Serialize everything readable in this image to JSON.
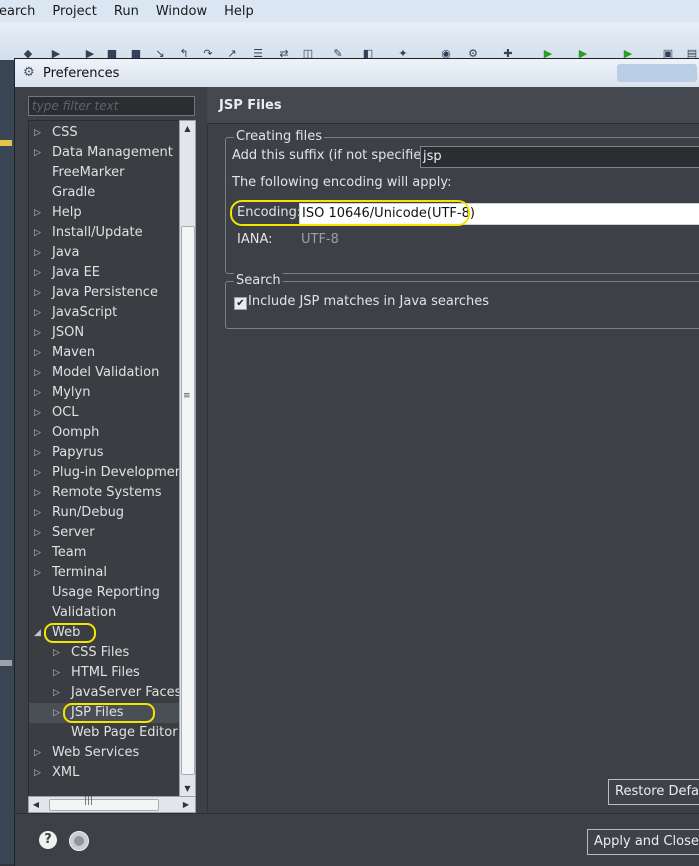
{
  "menubar": {
    "items": [
      "earch",
      "Project",
      "Run",
      "Window",
      "Help"
    ]
  },
  "dialog": {
    "title": "Preferences"
  },
  "filter": {
    "placeholder": "type filter text"
  },
  "tree": {
    "items": [
      {
        "label": "CSS",
        "arrow": "▷",
        "level": 0
      },
      {
        "label": "Data Management",
        "arrow": "▷",
        "level": 0
      },
      {
        "label": "FreeMarker",
        "arrow": "",
        "level": 0
      },
      {
        "label": "Gradle",
        "arrow": "",
        "level": 0
      },
      {
        "label": "Help",
        "arrow": "▷",
        "level": 0
      },
      {
        "label": "Install/Update",
        "arrow": "▷",
        "level": 0
      },
      {
        "label": "Java",
        "arrow": "▷",
        "level": 0
      },
      {
        "label": "Java EE",
        "arrow": "▷",
        "level": 0
      },
      {
        "label": "Java Persistence",
        "arrow": "▷",
        "level": 0
      },
      {
        "label": "JavaScript",
        "arrow": "▷",
        "level": 0
      },
      {
        "label": "JSON",
        "arrow": "▷",
        "level": 0
      },
      {
        "label": "Maven",
        "arrow": "▷",
        "level": 0
      },
      {
        "label": "Model Validation",
        "arrow": "▷",
        "level": 0
      },
      {
        "label": "Mylyn",
        "arrow": "▷",
        "level": 0
      },
      {
        "label": "OCL",
        "arrow": "▷",
        "level": 0
      },
      {
        "label": "Oomph",
        "arrow": "▷",
        "level": 0
      },
      {
        "label": "Papyrus",
        "arrow": "▷",
        "level": 0
      },
      {
        "label": "Plug-in Development",
        "arrow": "▷",
        "level": 0
      },
      {
        "label": "Remote Systems",
        "arrow": "▷",
        "level": 0
      },
      {
        "label": "Run/Debug",
        "arrow": "▷",
        "level": 0
      },
      {
        "label": "Server",
        "arrow": "▷",
        "level": 0
      },
      {
        "label": "Team",
        "arrow": "▷",
        "level": 0
      },
      {
        "label": "Terminal",
        "arrow": "▷",
        "level": 0
      },
      {
        "label": "Usage Reporting",
        "arrow": "",
        "level": 0
      },
      {
        "label": "Validation",
        "arrow": "",
        "level": 0
      },
      {
        "label": "Web",
        "arrow": "◢",
        "level": 0
      },
      {
        "label": "CSS Files",
        "arrow": "▷",
        "level": 1
      },
      {
        "label": "HTML Files",
        "arrow": "▷",
        "level": 1
      },
      {
        "label": "JavaServer Faces T",
        "arrow": "▷",
        "level": 1
      },
      {
        "label": "JSP Files",
        "arrow": "▷",
        "level": 1
      },
      {
        "label": "Web Page Editor",
        "arrow": "",
        "level": 1
      },
      {
        "label": "Web Services",
        "arrow": "▷",
        "level": 0
      },
      {
        "label": "XML",
        "arrow": "▷",
        "level": 0
      }
    ]
  },
  "page": {
    "title": "JSP Files",
    "creating_group": {
      "legend": "Creating files",
      "suffix_label": "Add this suffix (if not specified):",
      "suffix_value": "jsp",
      "encoding_note": "The following encoding will apply:",
      "encoding_label": "Encoding:",
      "encoding_value": "ISO 10646/Unicode(UTF-8)",
      "iana_label": "IANA:",
      "iana_value": "UTF-8"
    },
    "search_group": {
      "legend": "Search",
      "include_label": "Include JSP matches in Java searches",
      "include_checked": true
    },
    "restore_label": "Restore Defaul"
  },
  "footer": {
    "apply_close_label": "Apply and Close"
  },
  "colors": {
    "highlight": "#f2e600"
  }
}
